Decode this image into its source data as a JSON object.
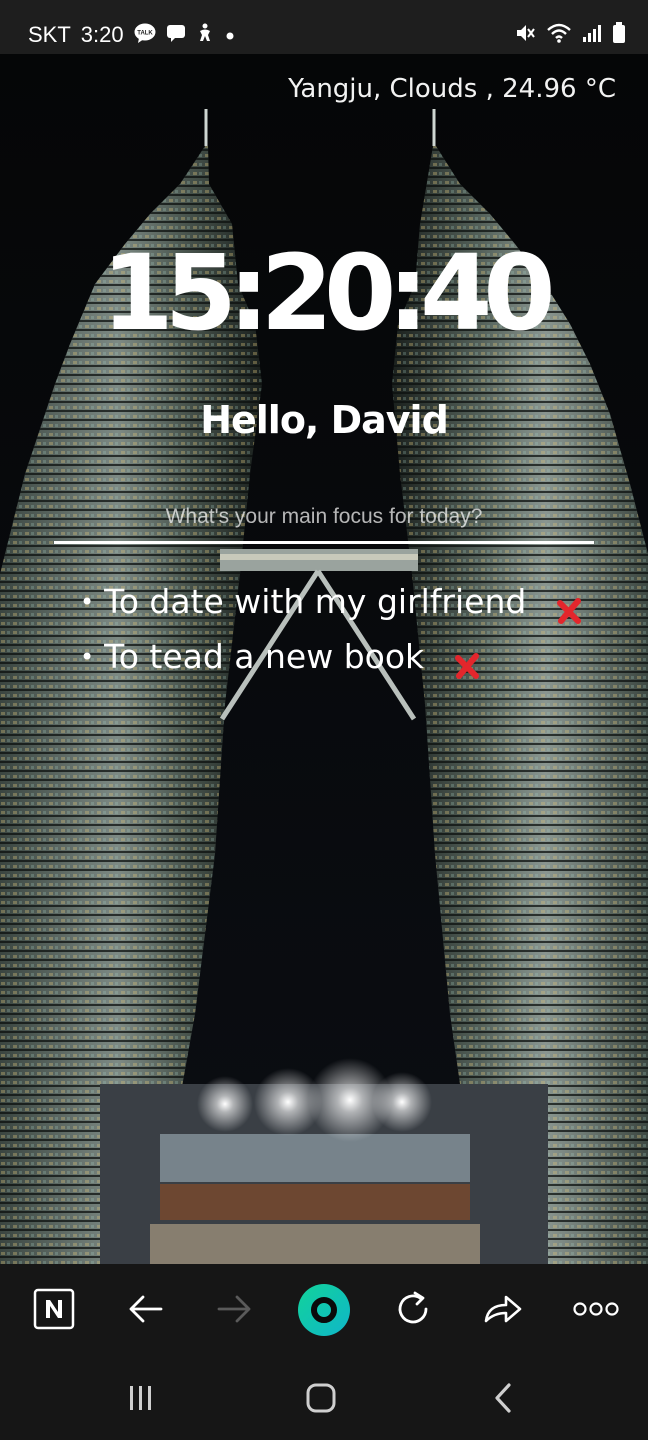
{
  "status_bar": {
    "carrier": "SKT",
    "time": "3:20",
    "chat_badge": "TALK"
  },
  "weather": {
    "text": "Yangju, Clouds , 24.96 °C"
  },
  "clock": {
    "time": "15:20:40"
  },
  "greeting": {
    "text": "Hello, David"
  },
  "focus": {
    "placeholder": "What's your main focus for today?"
  },
  "todos": [
    {
      "bullet": "•",
      "text": "To date with my girlfriend"
    },
    {
      "bullet": "•",
      "text": "To tead a new book"
    }
  ],
  "toolbar": {
    "home_icon": "naver-n-icon",
    "back_icon": "arrow-left-icon",
    "forward_icon": "arrow-right-icon",
    "center_icon": "green-circle-icon",
    "refresh_icon": "refresh-icon",
    "share_icon": "share-icon",
    "more_icon": "more-dots-icon"
  },
  "colors": {
    "delete_x": "#e3262c",
    "accent_green": "#19c37d",
    "toolbar_bg": "#161616"
  }
}
